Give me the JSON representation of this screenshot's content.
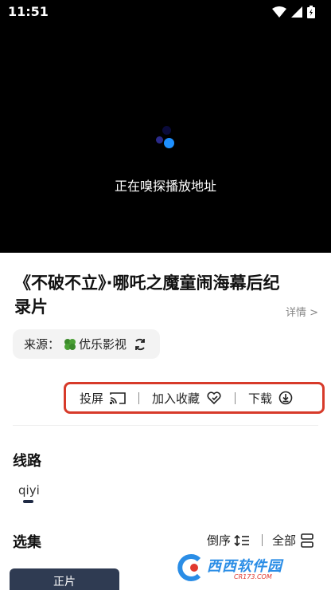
{
  "status_bar": {
    "time": "11:51"
  },
  "player": {
    "loading_text": "正在嗅探播放地址"
  },
  "video": {
    "title": "《不破不立》·哪吒之魔童闹海幕后纪录片",
    "details_link": "详情 >"
  },
  "source": {
    "label": "来源：",
    "name": "优乐影视"
  },
  "actions": {
    "cast_label": "投屏",
    "favorite_label": "加入收藏",
    "download_label": "下载",
    "highlight_color": "#d73a2a"
  },
  "route": {
    "heading": "线路",
    "items": [
      "qiyi"
    ]
  },
  "episodes": {
    "heading": "选集",
    "sort_label": "倒序",
    "all_label": "全部",
    "items": [
      "正片"
    ]
  },
  "watermark": {
    "text": "西西软件园",
    "sub": "CR173.COM"
  },
  "colors": {
    "accent_dark": "#2f3b52",
    "loader_blue": "#1e90ff",
    "loader_navy": "#1a1a7a"
  }
}
